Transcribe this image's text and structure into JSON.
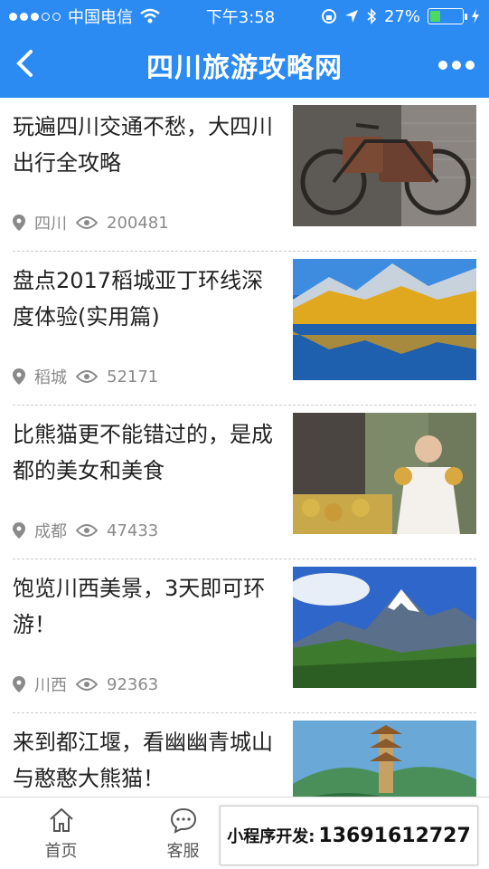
{
  "status": {
    "carrier": "中国电信",
    "time": "下午3:58",
    "battery": "27%"
  },
  "nav": {
    "title": "四川旅游攻略网"
  },
  "articles": [
    {
      "title": "玩遍四川交通不愁，大四川出行全攻略",
      "location": "四川",
      "views": "200481"
    },
    {
      "title": "盘点2017稻城亚丁环线深度体验(实用篇)",
      "location": "稻城",
      "views": "52171"
    },
    {
      "title": "比熊猫更不能错过的，是成都的美女和美食",
      "location": "成都",
      "views": "47433"
    },
    {
      "title": "饱览川西美景，3天即可环游！",
      "location": "川西",
      "views": "92363"
    },
    {
      "title": "来到都江堰，看幽幽青城山与憨憨大熊猫！",
      "location": "",
      "views": ""
    }
  ],
  "tabs": [
    {
      "label": "首页",
      "icon": "home-icon"
    },
    {
      "label": "客服",
      "icon": "chat-icon"
    }
  ],
  "dev_banner": {
    "label": "小程序开发:",
    "phone": "13691612727"
  },
  "colors": {
    "accent": "#2b8bf3"
  }
}
